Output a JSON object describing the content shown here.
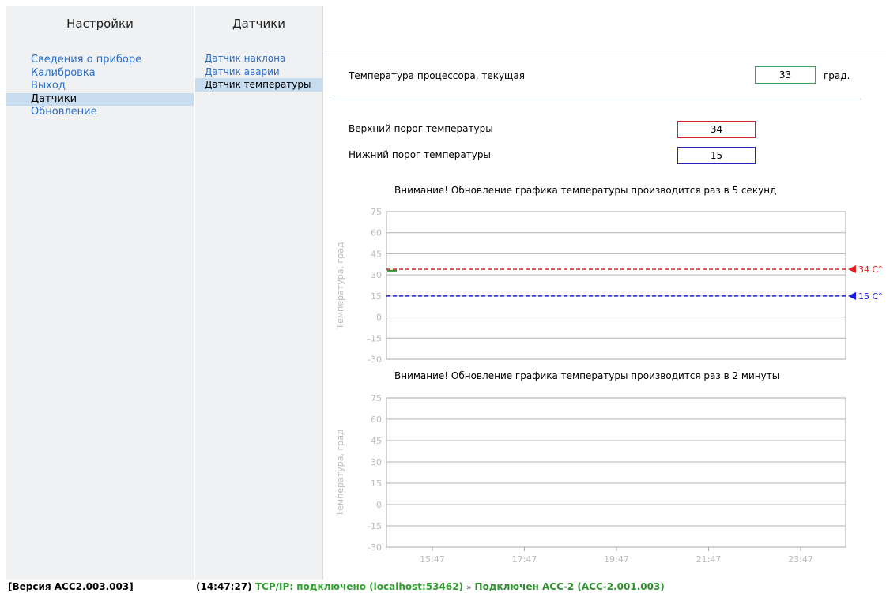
{
  "settings": {
    "title": "Настройки",
    "items": [
      {
        "label": "Сведения о приборе",
        "active": false
      },
      {
        "label": "Калибровка",
        "active": false
      },
      {
        "label": "Выход",
        "active": false
      },
      {
        "label": "Датчики",
        "active": true
      },
      {
        "label": "Обновление",
        "active": false
      }
    ]
  },
  "sensors": {
    "title": "Датчики",
    "items": [
      {
        "label": "Датчик наклона",
        "active": false
      },
      {
        "label": "Датчик аварии",
        "active": false
      },
      {
        "label": "Датчик температуры",
        "active": true
      }
    ]
  },
  "main": {
    "cpu_temp_label": "Температура процессора, текущая",
    "cpu_temp_value": "33",
    "cpu_temp_unit": "град.",
    "upper_label": "Верхний порог температуры",
    "upper_value": "34",
    "lower_label": "Нижний порог температуры",
    "lower_value": "15"
  },
  "chart_data": [
    {
      "type": "line",
      "title": "Внимание! Обновление графика температуры производится раз в 5 секунд",
      "ylabel": "Температура, град",
      "ylim": [
        -30,
        75
      ],
      "yticks": [
        "75",
        "60",
        "45",
        "30",
        "15",
        "0",
        "-15",
        "-30"
      ],
      "grid": true,
      "thresholds": [
        {
          "value": 34,
          "label": "34 С°",
          "color": "#e02020"
        },
        {
          "value": 15,
          "label": "15 С°",
          "color": "#1a1ae0"
        }
      ],
      "series": [
        {
          "values": [
            33,
            33
          ]
        }
      ]
    },
    {
      "type": "line",
      "title": "Внимание! Обновление графика температуры производится раз в 2 минуты",
      "ylabel": "Температура, град",
      "ylim": [
        -30,
        75
      ],
      "yticks": [
        "75",
        "60",
        "45",
        "30",
        "15",
        "0",
        "-15",
        "-30"
      ],
      "xticks": [
        "15:47",
        "17:47",
        "19:47",
        "21:47",
        "23:47"
      ],
      "grid": true,
      "series": []
    }
  ],
  "statusbar": {
    "version": "[Версия ACC2.003.003]",
    "time": "(14:47:27)",
    "tcp": "TCP/IP: подключено (localhost:53462)",
    "arrow": "»",
    "connected": "Подключен АСС-2 (АСС-2.001.003)"
  }
}
